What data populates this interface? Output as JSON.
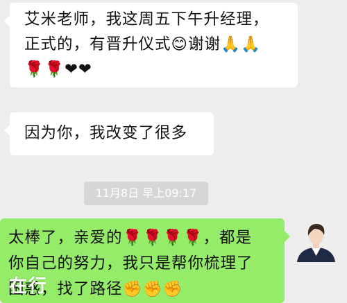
{
  "chat": {
    "messages": [
      {
        "direction": "incoming",
        "lines": [
          "艾米老师，我这周五下午升经理，",
          "正式的，有晋升仪式😊谢谢🙏🙏",
          "🌹🌹❤❤"
        ]
      },
      {
        "direction": "incoming",
        "lines": [
          "因为你，我改变了很多"
        ]
      },
      {
        "direction": "outgoing",
        "lines": [
          "太棒了，亲爱的🌹🌹🌹🌹，都是",
          "你自己的努力，我只是帮你梳理了",
          "困惑，找了路径✊✊✊"
        ]
      }
    ],
    "timestamp": "11月8日 早上09:17"
  },
  "watermark": "在行",
  "colors": {
    "background": "#ededed",
    "incoming_bubble": "#ffffff",
    "outgoing_bubble": "#95ec69",
    "timestamp_badge": "#d6d6d6"
  },
  "avatar": {
    "icon": "user-avatar-icon"
  }
}
